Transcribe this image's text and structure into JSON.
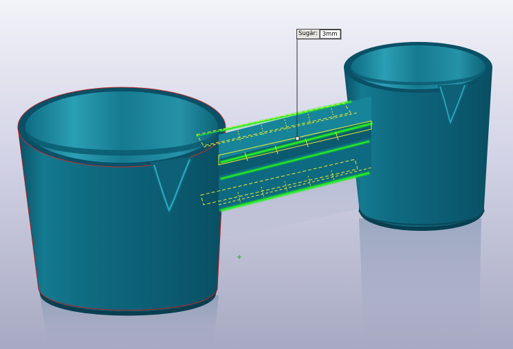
{
  "viewport": {
    "background_top": "#ececf4",
    "background_bottom": "#a8aabf"
  },
  "model": {
    "body_color": "#0b5c72",
    "body_highlight": "#1f8ea6",
    "selection_color": "#22ee22",
    "preview_color": "#eeee22",
    "edge_color": "#b02020"
  },
  "dimension": {
    "label": "Sugár:",
    "value": "3mm"
  }
}
